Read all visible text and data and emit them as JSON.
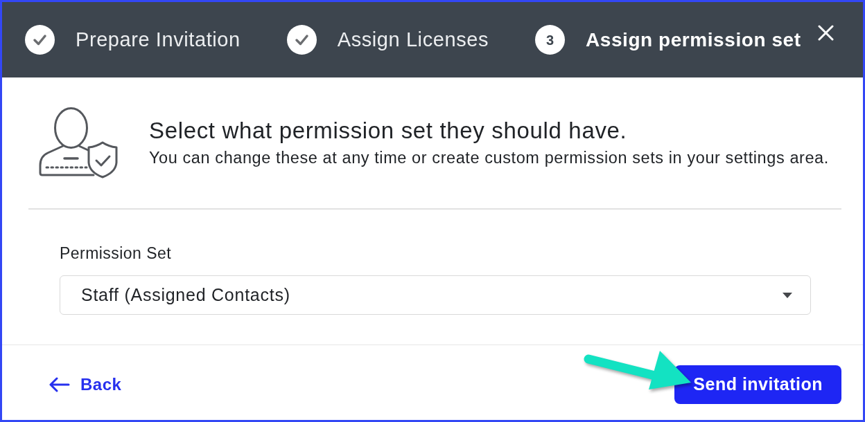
{
  "steps": [
    {
      "kind": "completed",
      "label": "Prepare Invitation"
    },
    {
      "kind": "completed",
      "label": "Assign Licenses"
    },
    {
      "kind": "current",
      "number": "3",
      "label": "Assign permission set"
    }
  ],
  "intro": {
    "heading": "Select what permission set they should have.",
    "subtitle": "You can change these at any time or create custom permission sets in your settings area."
  },
  "field": {
    "label": "Permission Set",
    "value": "Staff (Assigned Contacts)"
  },
  "footer": {
    "back": "Back",
    "primary": "Send invitation"
  }
}
